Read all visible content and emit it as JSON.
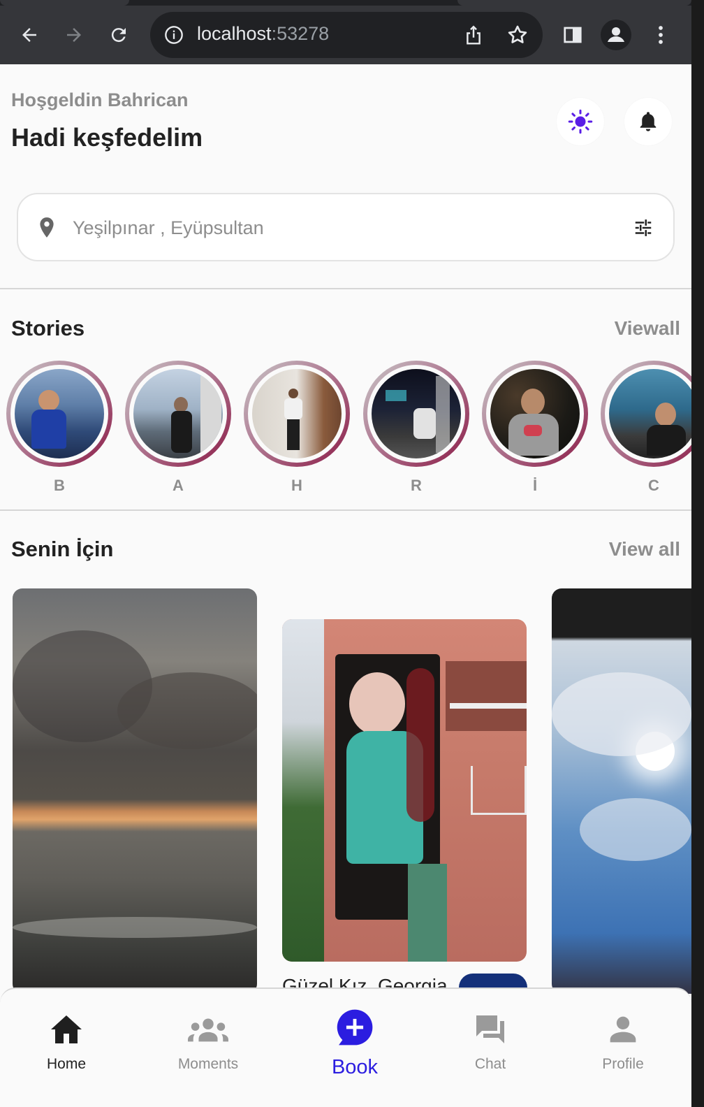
{
  "browser": {
    "url_host": "localhost",
    "url_port": ":53278"
  },
  "header": {
    "greeting": "Hoşgeldin Bahrican",
    "headline": "Hadi keşfedelim"
  },
  "search": {
    "placeholder": "Yeşilpınar , Eyüpsultan"
  },
  "stories": {
    "title": "Stories",
    "view_all": "Viewall",
    "items": [
      {
        "label": "B"
      },
      {
        "label": "A"
      },
      {
        "label": "H"
      },
      {
        "label": "R"
      },
      {
        "label": "İ"
      },
      {
        "label": "C"
      }
    ]
  },
  "for_you": {
    "title": "Senin İçin",
    "view_all": "View all",
    "card_caption": "Güzel Kız, Georgia"
  },
  "nav": {
    "items": [
      {
        "label": "Home",
        "icon": "home-icon"
      },
      {
        "label": "Moments",
        "icon": "groups-icon"
      },
      {
        "label": "Book",
        "icon": "add-chat-icon"
      },
      {
        "label": "Chat",
        "icon": "forum-icon"
      },
      {
        "label": "Profile",
        "icon": "person-icon"
      }
    ],
    "active": "Home"
  },
  "colors": {
    "accent": "#2b1de0",
    "sun_icon": "#5a1ee6",
    "story_ring": "#8b1a46",
    "rating_pill": "#14307a"
  }
}
